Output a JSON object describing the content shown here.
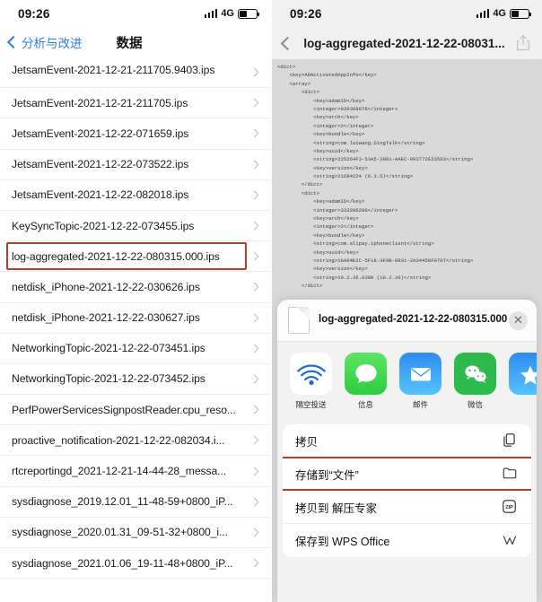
{
  "status_bar": {
    "time": "09:26",
    "network": "4G"
  },
  "left_screen": {
    "nav": {
      "back_label": "分析与改进",
      "title": "数据"
    },
    "files": [
      "JetsamEvent-2021-12-21-211705.9403.ips",
      "JetsamEvent-2021-12-21-211705.ips",
      "JetsamEvent-2021-12-22-071659.ips",
      "JetsamEvent-2021-12-22-073522.ips",
      "JetsamEvent-2021-12-22-082018.ips",
      "KeySyncTopic-2021-12-22-073455.ips",
      "log-aggregated-2021-12-22-080315.000.ips",
      "netdisk_iPhone-2021-12-22-030626.ips",
      "netdisk_iPhone-2021-12-22-030627.ips",
      "NetworkingTopic-2021-12-22-073451.ips",
      "NetworkingTopic-2021-12-22-073452.ips",
      "PerfPowerServicesSignpostReader.cpu_reso...",
      "proactive_notification-2021-12-22-082034.i...",
      "rtcreportingd_2021-12-21-14-44-28_messa...",
      "sysdiagnose_2019.12.01_11-48-59+0800_iP...",
      "sysdiagnose_2020.01.31_09-51-32+0800_i...",
      "sysdiagnose_2021.01.06_19-11-48+0800_iP..."
    ],
    "highlighted_file_index": 6,
    "highlight_color": "#c0392b"
  },
  "right_screen": {
    "nav": {
      "title": "log-aggregated-2021-12-22-08031...",
      "share_icon": "share-icon",
      "back_icon": "chevron-left-icon"
    },
    "plist_lines": [
      "<dict>",
      "    <key>ADActivatedAppInfo</key>",
      "    <array>",
      "        <dict>",
      "            <key>adamID</key>",
      "            <integer>930368978</integer>",
      "            <key>arch</key>",
      "            <integer>2</integer>",
      "            <key>bundle</key>",
      "            <string>com.laiwang.DingTalk</string>",
      "            <key>uuid</key>",
      "            <string>225264F3-53A5-3901-AAEC-993772E23593</string>",
      "            <key>version</key>",
      "            <string>21684224 (6.3.5)</string>",
      "        </dict>",
      "        <dict>",
      "            <key>adamID</key>",
      "            <integer>333206289</integer>",
      "            <key>arch</key>",
      "            <integer>2</integer>",
      "            <key>bundle</key>",
      "            <string>com.alipay.iphoneclient</string>",
      "            <key>uuid</key>",
      "            <string>16A04E2C-5F18-3F9B-8931-2A34450F0707</string>",
      "            <key>version</key>",
      "            <string>10.2.36.6300 (10.2.36)</string>",
      "        </dict>"
    ],
    "share_sheet": {
      "file_name": "log-aggregated-2021-12-22-080315.000",
      "close_label": "✕",
      "apps": [
        {
          "label": "隔空投送",
          "icon": "airdrop-icon",
          "color": "#ffffff"
        },
        {
          "label": "信息",
          "icon": "messages-icon",
          "color": "#2ecc41"
        },
        {
          "label": "邮件",
          "icon": "mail-icon",
          "color": "#2e8cf0"
        },
        {
          "label": "微信",
          "icon": "wechat-icon",
          "color": "#2ebb4e"
        },
        {
          "label": "",
          "icon": "cut-app-icon",
          "color": "#2e8cf0"
        }
      ],
      "actions": [
        {
          "label": "拷贝",
          "icon": "copy-icon"
        },
        {
          "label": "存储到“文件”",
          "icon": "folder-icon"
        },
        {
          "label": "拷贝到 解压专家",
          "icon": "zip-icon"
        },
        {
          "label": "保存到 WPS Office",
          "icon": "wps-icon"
        }
      ],
      "highlighted_action_index": 1
    }
  }
}
